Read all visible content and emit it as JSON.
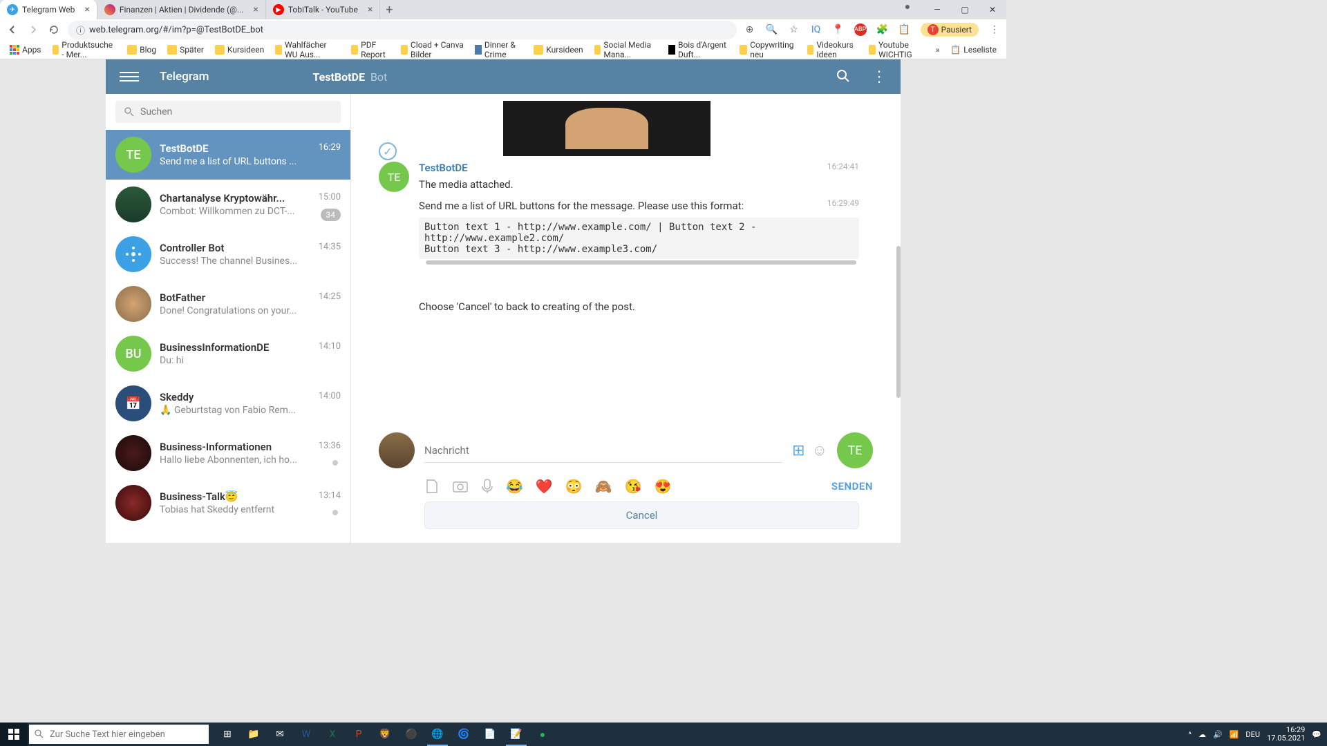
{
  "browser": {
    "tabs": [
      {
        "title": "Telegram Web",
        "active": true,
        "icon_bg": "#3ba1e4"
      },
      {
        "title": "Finanzen | Aktien | Dividende (@...",
        "active": false,
        "icon_bg": "linear-gradient(45deg,#f09433,#bc1888)"
      },
      {
        "title": "TobiTalk - YouTube",
        "active": false,
        "icon_bg": "#ff0000"
      }
    ],
    "url": "web.telegram.org/#/im?p=@TestBotDE_bot",
    "paused_label": "Pausiert",
    "bookmarks": [
      "Apps",
      "Produktsuche - Mer...",
      "Blog",
      "Später",
      "Kursideen",
      "Wahlfächer WU Aus...",
      "PDF Report",
      "Cload + Canva Bilder",
      "Dinner & Crime",
      "Kursideen",
      "Social Media Mana...",
      "Bois d'Argent Duft...",
      "Copywriting neu",
      "Videokurs Ideen",
      "Youtube WICHTIG"
    ],
    "reading_list": "Leseliste"
  },
  "telegram": {
    "app_title": "Telegram",
    "chat_header_name": "TestBotDE",
    "chat_header_type": "Bot",
    "search_placeholder": "Suchen",
    "chats": [
      {
        "name": "TestBotDE",
        "preview": "Send me a list of URL buttons ...",
        "time": "16:29",
        "avatar_text": "TE",
        "avatar_bg": "#76c84d",
        "active": true
      },
      {
        "name": "Chartanalyse Kryptowähr...",
        "preview": "Combot: Willkommen zu DCT-...",
        "time": "15:00",
        "badge": "34"
      },
      {
        "name": "Controller Bot",
        "preview": "Success! The channel Busines...",
        "time": "14:35",
        "avatar_bg": "#3ba1e4"
      },
      {
        "name": "BotFather",
        "preview": "Done! Congratulations on your...",
        "time": "14:25"
      },
      {
        "name": "BusinessInformationDE",
        "preview": "Du: hi",
        "time": "14:10",
        "avatar_text": "BU",
        "avatar_bg": "#76c84d"
      },
      {
        "name": "Skeddy",
        "preview": "🙏 Geburtstag von Fabio Rem...",
        "time": "14:00",
        "avatar_bg": "#2a4d7a"
      },
      {
        "name": "Business-Informationen",
        "preview": "Hallo liebe Abonnenten, ich ho...",
        "time": "13:36",
        "dot": true
      },
      {
        "name": "Business-Talk😇",
        "preview": "Tobias hat Skeddy entfernt",
        "time": "13:14",
        "dot": true
      }
    ],
    "messages": {
      "sender": "TestBotDE",
      "msg1_text": "The media attached.",
      "msg1_time": "16:24:41",
      "msg2_text": "Send me a list of URL buttons for the message. Please use this format:",
      "msg2_time": "16:29:49",
      "code": "Button text 1 - http://www.example.com/ | Button text 2 - http://www.example2.com/\nButton text 3 - http://www.example3.com/",
      "msg3_text": "Choose 'Cancel' to back to creating of the post."
    },
    "composer": {
      "placeholder": "Nachricht",
      "send_label": "SENDEN",
      "cancel_label": "Cancel",
      "emojis": [
        "😂",
        "❤️",
        "😳",
        "🙈",
        "😘",
        "😍"
      ]
    }
  },
  "taskbar": {
    "search_placeholder": "Zur Suche Text hier eingeben",
    "lang": "DEU",
    "time": "16:29",
    "date": "17.05.2021"
  }
}
